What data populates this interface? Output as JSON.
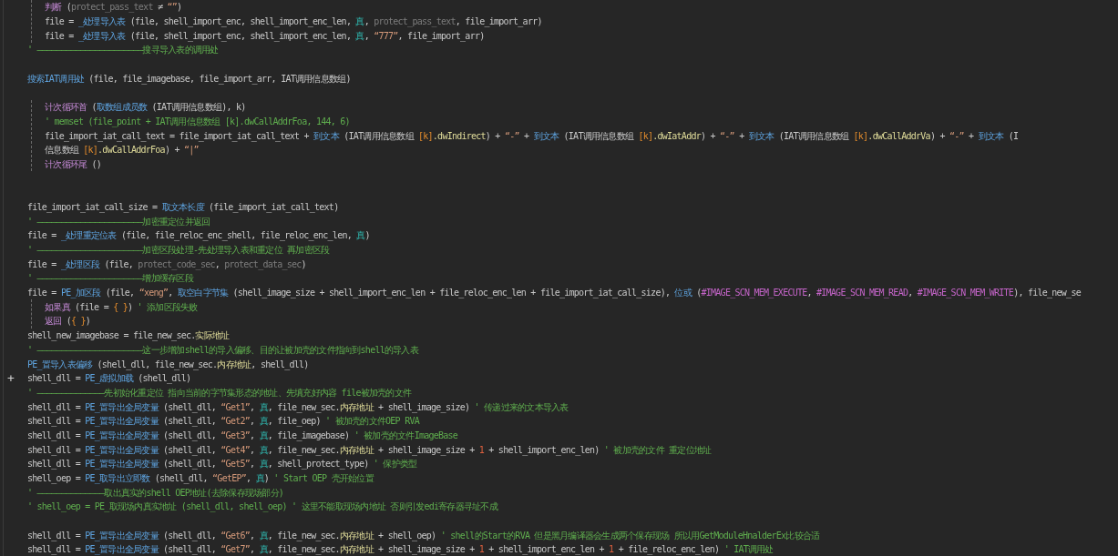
{
  "lines": [
    {
      "kind": "block",
      "children": [
        {
          "kind": "code",
          "tokens": [
            {
              "kind": "command",
              "text": "判断"
            },
            {
              "kind": "plain",
              "text": " ("
            },
            {
              "kind": "dim",
              "text": "protect_pass_text"
            },
            {
              "kind": "plain",
              "text": " ≠ "
            },
            {
              "kind": "string",
              "text": "“”"
            },
            {
              "kind": "plain",
              "text": ")"
            }
          ]
        },
        {
          "kind": "code",
          "tokens": [
            {
              "kind": "plain",
              "text": "file = "
            },
            {
              "kind": "func",
              "text": "_处理导入表"
            },
            {
              "kind": "plain",
              "text": " (file, shell_import_enc, shell_import_enc_len, "
            },
            {
              "kind": "const",
              "text": "真"
            },
            {
              "kind": "plain",
              "text": ", "
            },
            {
              "kind": "dim",
              "text": "protect_pass_text"
            },
            {
              "kind": "plain",
              "text": ", file_import_arr)"
            }
          ]
        },
        {
          "kind": "code",
          "tokens": [
            {
              "kind": "plain",
              "text": "file = "
            },
            {
              "kind": "func",
              "text": "_处理导入表"
            },
            {
              "kind": "plain",
              "text": " (file, shell_import_enc, shell_import_enc_len, "
            },
            {
              "kind": "const",
              "text": "真"
            },
            {
              "kind": "plain",
              "text": ", "
            },
            {
              "kind": "string",
              "text": "“777”"
            },
            {
              "kind": "plain",
              "text": ", file_import_arr)"
            }
          ]
        }
      ]
    },
    {
      "kind": "code",
      "tokens": [
        {
          "kind": "comment",
          "text": "' ——————————————————————搜寻导入表的调用处"
        }
      ]
    },
    {
      "kind": "blank"
    },
    {
      "kind": "code",
      "tokens": [
        {
          "kind": "func",
          "text": "搜索IAT调用处"
        },
        {
          "kind": "plain",
          "text": " (file, file_imagebase, file_import_arr, IAT调用信息数组)"
        }
      ]
    },
    {
      "kind": "blank"
    },
    {
      "kind": "block",
      "children": [
        {
          "kind": "code",
          "tokens": [
            {
              "kind": "command",
              "text": "计次循环首"
            },
            {
              "kind": "plain",
              "text": " ("
            },
            {
              "kind": "func",
              "text": "取数组成员数"
            },
            {
              "kind": "plain",
              "text": " (IAT调用信息数组), k)"
            }
          ]
        },
        {
          "kind": "code",
          "tokens": [
            {
              "kind": "comment",
              "text": "' memset (file_point + IAT调用信息数组 [k].dwCallAddrFoa, 144, 6)"
            }
          ]
        },
        {
          "kind": "code",
          "tokens": [
            {
              "kind": "plain",
              "text": "file_import_iat_call_text = file_import_iat_call_text + "
            },
            {
              "kind": "func",
              "text": "到文本"
            },
            {
              "kind": "plain",
              "text": " (IAT调用信息数组 "
            },
            {
              "kind": "bracket",
              "text": "[k]"
            },
            {
              "kind": "member",
              "text": ".dwIndirect"
            },
            {
              "kind": "plain",
              "text": ") + "
            },
            {
              "kind": "string",
              "text": "“-”"
            },
            {
              "kind": "plain",
              "text": " + "
            },
            {
              "kind": "func",
              "text": "到文本"
            },
            {
              "kind": "plain",
              "text": " (IAT调用信息数组 "
            },
            {
              "kind": "bracket",
              "text": "[k]"
            },
            {
              "kind": "member",
              "text": ".dwIatAddr"
            },
            {
              "kind": "plain",
              "text": ") + "
            },
            {
              "kind": "string",
              "text": "“-”"
            },
            {
              "kind": "plain",
              "text": " + "
            },
            {
              "kind": "func",
              "text": "到文本"
            },
            {
              "kind": "plain",
              "text": " (IAT调用信息数组 "
            },
            {
              "kind": "bracket",
              "text": "[k]"
            },
            {
              "kind": "member",
              "text": ".dwCallAddrVa"
            },
            {
              "kind": "plain",
              "text": ") + "
            },
            {
              "kind": "string",
              "text": "“-”"
            },
            {
              "kind": "plain",
              "text": " + "
            },
            {
              "kind": "func",
              "text": "到文本"
            },
            {
              "kind": "plain",
              "text": " (I"
            }
          ]
        },
        {
          "kind": "code",
          "tokens": [
            {
              "kind": "plain",
              "text": "信息数组 "
            },
            {
              "kind": "bracket",
              "text": "[k]"
            },
            {
              "kind": "member",
              "text": ".dwCallAddrFoa"
            },
            {
              "kind": "plain",
              "text": ") + "
            },
            {
              "kind": "string",
              "text": "“|”"
            }
          ]
        },
        {
          "kind": "code",
          "tokens": [
            {
              "kind": "command",
              "text": "计次循环尾"
            },
            {
              "kind": "plain",
              "text": " ()"
            }
          ]
        }
      ]
    },
    {
      "kind": "blank"
    },
    {
      "kind": "blank"
    },
    {
      "kind": "code",
      "tokens": [
        {
          "kind": "plain",
          "text": "file_import_iat_call_size = "
        },
        {
          "kind": "func",
          "text": "取文本长度"
        },
        {
          "kind": "plain",
          "text": " (file_import_iat_call_text)"
        }
      ]
    },
    {
      "kind": "code",
      "tokens": [
        {
          "kind": "comment",
          "text": "' ——————————————————————加密重定位并返回"
        }
      ]
    },
    {
      "kind": "code",
      "tokens": [
        {
          "kind": "plain",
          "text": "file = "
        },
        {
          "kind": "func",
          "text": "_处理重定位表"
        },
        {
          "kind": "plain",
          "text": " (file, file_reloc_enc_shell, file_reloc_enc_len, "
        },
        {
          "kind": "const",
          "text": "真"
        },
        {
          "kind": "plain",
          "text": ")"
        }
      ]
    },
    {
      "kind": "code",
      "tokens": [
        {
          "kind": "comment",
          "text": "' ——————————————————————加密区段处理-先处理导入表和重定位 再加密区段"
        }
      ]
    },
    {
      "kind": "code",
      "tokens": [
        {
          "kind": "plain",
          "text": "file = "
        },
        {
          "kind": "func",
          "text": "_处理区段"
        },
        {
          "kind": "plain",
          "text": " (file, "
        },
        {
          "kind": "dim",
          "text": "protect_code_sec"
        },
        {
          "kind": "plain",
          "text": ", "
        },
        {
          "kind": "dim",
          "text": "protect_data_sec"
        },
        {
          "kind": "plain",
          "text": ")"
        }
      ]
    },
    {
      "kind": "code",
      "tokens": [
        {
          "kind": "comment",
          "text": "' ——————————————————————增加缓存区段"
        }
      ]
    },
    {
      "kind": "code",
      "tokens": [
        {
          "kind": "plain",
          "text": "file = "
        },
        {
          "kind": "func",
          "text": "PE_加区段"
        },
        {
          "kind": "plain",
          "text": " (file, "
        },
        {
          "kind": "string",
          "text": "“xeng”"
        },
        {
          "kind": "plain",
          "text": ", "
        },
        {
          "kind": "func",
          "text": "取空白字节集"
        },
        {
          "kind": "plain",
          "text": " (shell_image_size + shell_import_enc_len + file_reloc_enc_len + file_import_iat_call_size), "
        },
        {
          "kind": "func",
          "text": "位或"
        },
        {
          "kind": "plain",
          "text": " ("
        },
        {
          "kind": "macro",
          "text": "#IMAGE_SCN_MEM_EXECUTE"
        },
        {
          "kind": "plain",
          "text": ", "
        },
        {
          "kind": "macro",
          "text": "#IMAGE_SCN_MEM_READ"
        },
        {
          "kind": "plain",
          "text": ", "
        },
        {
          "kind": "macro",
          "text": "#IMAGE_SCN_MEM_WRITE"
        },
        {
          "kind": "plain",
          "text": "), file_new_se"
        }
      ]
    },
    {
      "kind": "block",
      "children": [
        {
          "kind": "code",
          "tokens": [
            {
              "kind": "command",
              "text": "如果真"
            },
            {
              "kind": "plain",
              "text": " (file = "
            },
            {
              "kind": "bracket",
              "text": "{ }"
            },
            {
              "kind": "plain",
              "text": ") "
            },
            {
              "kind": "comment",
              "text": "' 添加区段失败"
            }
          ]
        },
        {
          "kind": "code",
          "tokens": [
            {
              "kind": "command",
              "text": "返回"
            },
            {
              "kind": "plain",
              "text": " ("
            },
            {
              "kind": "bracket",
              "text": "{ }"
            },
            {
              "kind": "plain",
              "text": ")"
            }
          ]
        }
      ]
    },
    {
      "kind": "code",
      "tokens": [
        {
          "kind": "plain",
          "text": "shell_new_imagebase = file_new_sec."
        },
        {
          "kind": "member",
          "text": "实际地址"
        }
      ]
    },
    {
      "kind": "code",
      "tokens": [
        {
          "kind": "comment",
          "text": "' ——————————————————————这一步增加shell的导入偏移、目的让被加壳的文件指向到shell的导入表"
        }
      ]
    },
    {
      "kind": "code",
      "tokens": [
        {
          "kind": "func",
          "text": "PE_置导入表偏移"
        },
        {
          "kind": "plain",
          "text": " (shell_dll, file_new_sec."
        },
        {
          "kind": "member",
          "text": "内存地址"
        },
        {
          "kind": "plain",
          "text": ", shell_dll)"
        }
      ]
    },
    {
      "kind": "code",
      "gutter": "+",
      "tokens": [
        {
          "kind": "plain",
          "text": "shell_dll = "
        },
        {
          "kind": "func",
          "text": "PE_虚拟加载"
        },
        {
          "kind": "plain",
          "text": " (shell_dll)"
        }
      ]
    },
    {
      "kind": "code",
      "tokens": [
        {
          "kind": "comment",
          "text": "' ——————————————先初始化重定位 指向当前的字节集形态的地址、先填充好内容 file被加壳的文件"
        }
      ]
    },
    {
      "kind": "code",
      "tokens": [
        {
          "kind": "plain",
          "text": "shell_dll = "
        },
        {
          "kind": "func",
          "text": "PE_置导出全局变量"
        },
        {
          "kind": "plain",
          "text": " (shell_dll, "
        },
        {
          "kind": "string",
          "text": "“Get1”"
        },
        {
          "kind": "plain",
          "text": ", "
        },
        {
          "kind": "const",
          "text": "真"
        },
        {
          "kind": "plain",
          "text": ", file_new_sec."
        },
        {
          "kind": "member",
          "text": "内存地址"
        },
        {
          "kind": "plain",
          "text": " + shell_image_size) "
        },
        {
          "kind": "comment",
          "text": "' 传递过来的文本导入表"
        }
      ]
    },
    {
      "kind": "code",
      "tokens": [
        {
          "kind": "plain",
          "text": "shell_dll = "
        },
        {
          "kind": "func",
          "text": "PE_置导出全局变量"
        },
        {
          "kind": "plain",
          "text": " (shell_dll, "
        },
        {
          "kind": "string",
          "text": "“Get2”"
        },
        {
          "kind": "plain",
          "text": ", "
        },
        {
          "kind": "const",
          "text": "真"
        },
        {
          "kind": "plain",
          "text": ", file_oep) "
        },
        {
          "kind": "comment",
          "text": "' 被加壳的文件OEP RVA"
        }
      ]
    },
    {
      "kind": "code",
      "tokens": [
        {
          "kind": "plain",
          "text": "shell_dll = "
        },
        {
          "kind": "func",
          "text": "PE_置导出全局变量"
        },
        {
          "kind": "plain",
          "text": " (shell_dll, "
        },
        {
          "kind": "string",
          "text": "“Get3”"
        },
        {
          "kind": "plain",
          "text": ", "
        },
        {
          "kind": "const",
          "text": "真"
        },
        {
          "kind": "plain",
          "text": ", file_imagebase) "
        },
        {
          "kind": "comment",
          "text": "' 被加壳的文件ImageBase"
        }
      ]
    },
    {
      "kind": "code",
      "tokens": [
        {
          "kind": "plain",
          "text": "shell_dll = "
        },
        {
          "kind": "func",
          "text": "PE_置导出全局变量"
        },
        {
          "kind": "plain",
          "text": " (shell_dll, "
        },
        {
          "kind": "string",
          "text": "“Get4”"
        },
        {
          "kind": "plain",
          "text": ", "
        },
        {
          "kind": "const",
          "text": "真"
        },
        {
          "kind": "plain",
          "text": ", file_new_sec."
        },
        {
          "kind": "member",
          "text": "内存地址"
        },
        {
          "kind": "plain",
          "text": " + shell_image_size + "
        },
        {
          "kind": "number",
          "text": "1"
        },
        {
          "kind": "plain",
          "text": " + shell_import_enc_len) "
        },
        {
          "kind": "comment",
          "text": "' 被加壳的文件 重定位地址"
        }
      ]
    },
    {
      "kind": "code",
      "tokens": [
        {
          "kind": "plain",
          "text": "shell_dll = "
        },
        {
          "kind": "func",
          "text": "PE_置导出全局变量"
        },
        {
          "kind": "plain",
          "text": " (shell_dll, "
        },
        {
          "kind": "string",
          "text": "“Get5”"
        },
        {
          "kind": "plain",
          "text": ", "
        },
        {
          "kind": "const",
          "text": "真"
        },
        {
          "kind": "plain",
          "text": ", shell_protect_type) "
        },
        {
          "kind": "comment",
          "text": "' 保护类型"
        }
      ]
    },
    {
      "kind": "code",
      "tokens": [
        {
          "kind": "plain",
          "text": "shell_oep = "
        },
        {
          "kind": "func",
          "text": "PE_取导出立即数"
        },
        {
          "kind": "plain",
          "text": " (shell_dll, "
        },
        {
          "kind": "string",
          "text": "“GetEP”"
        },
        {
          "kind": "plain",
          "text": ", "
        },
        {
          "kind": "const",
          "text": "真"
        },
        {
          "kind": "plain",
          "text": ") "
        },
        {
          "kind": "comment",
          "text": "' Start OEP 壳开始位置"
        }
      ]
    },
    {
      "kind": "code",
      "tokens": [
        {
          "kind": "comment",
          "text": "' ——————————————取出真实的shell OEP地址(去除保存现场部分)"
        }
      ]
    },
    {
      "kind": "code",
      "tokens": [
        {
          "kind": "comment",
          "text": "' shell_oep = PE_取现场内真实地址 (shell_dll, shell_oep) ' 这里不能取现场内地址 否则引发edi寄存器寻址不成"
        }
      ]
    },
    {
      "kind": "blank"
    },
    {
      "kind": "code",
      "tokens": [
        {
          "kind": "plain",
          "text": "shell_dll = "
        },
        {
          "kind": "func",
          "text": "PE_置导出全局变量"
        },
        {
          "kind": "plain",
          "text": " (shell_dll, "
        },
        {
          "kind": "string",
          "text": "“Get6”"
        },
        {
          "kind": "plain",
          "text": ", "
        },
        {
          "kind": "const",
          "text": "真"
        },
        {
          "kind": "plain",
          "text": ", file_new_sec."
        },
        {
          "kind": "member",
          "text": "内存地址"
        },
        {
          "kind": "plain",
          "text": " + shell_oep) "
        },
        {
          "kind": "comment",
          "text": "' shell的Start的RVA 但是黑月编译器会生成两个保存现场 所以用GetModuleHnalderEx比较合适"
        }
      ]
    },
    {
      "kind": "code",
      "tokens": [
        {
          "kind": "plain",
          "text": "shell_dll = "
        },
        {
          "kind": "func",
          "text": "PE_置导出全局变量"
        },
        {
          "kind": "plain",
          "text": " (shell_dll, "
        },
        {
          "kind": "string",
          "text": "“Get7”"
        },
        {
          "kind": "plain",
          "text": ", "
        },
        {
          "kind": "const",
          "text": "真"
        },
        {
          "kind": "plain",
          "text": ", file_new_sec."
        },
        {
          "kind": "member",
          "text": "内存地址"
        },
        {
          "kind": "plain",
          "text": " + shell_image_size + "
        },
        {
          "kind": "number",
          "text": "1"
        },
        {
          "kind": "plain",
          "text": " + shell_import_enc_len + "
        },
        {
          "kind": "number",
          "text": "1"
        },
        {
          "kind": "plain",
          "text": " + file_reloc_enc_len) "
        },
        {
          "kind": "comment",
          "text": "' IAT调用处"
        }
      ]
    }
  ]
}
